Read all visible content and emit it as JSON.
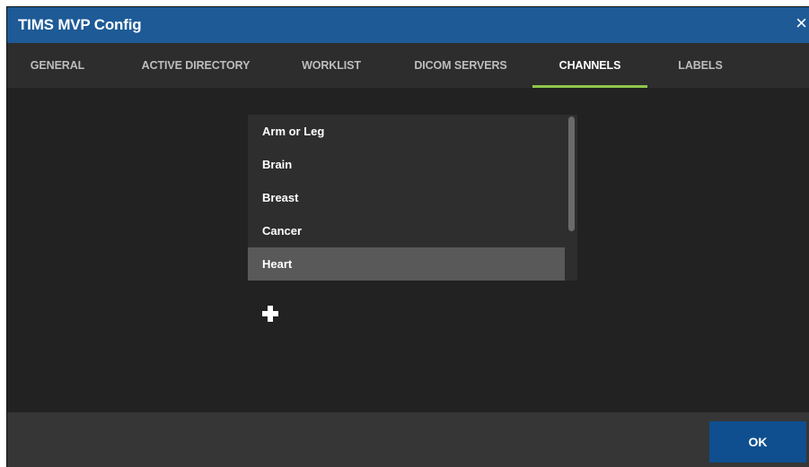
{
  "dialog": {
    "title": "TIMS MVP Config",
    "close_icon": "×"
  },
  "tabs": [
    {
      "label": "GENERAL",
      "active": false
    },
    {
      "label": "ACTIVE DIRECTORY",
      "active": false
    },
    {
      "label": "WORKLIST",
      "active": false
    },
    {
      "label": "DICOM SERVERS",
      "active": false
    },
    {
      "label": "CHANNELS",
      "active": true
    },
    {
      "label": "LABELS",
      "active": false
    }
  ],
  "channels": {
    "items": [
      "Arm or Leg",
      "Brain",
      "Breast",
      "Cancer",
      "Heart"
    ],
    "selected": "Heart",
    "add_icon": "plus-icon"
  },
  "footer": {
    "ok_label": "OK"
  },
  "colors": {
    "titlebar": "#1d5a96",
    "tab_indicator": "#8fc64c",
    "ok_button": "#0f4f8f",
    "background": "#222222"
  }
}
